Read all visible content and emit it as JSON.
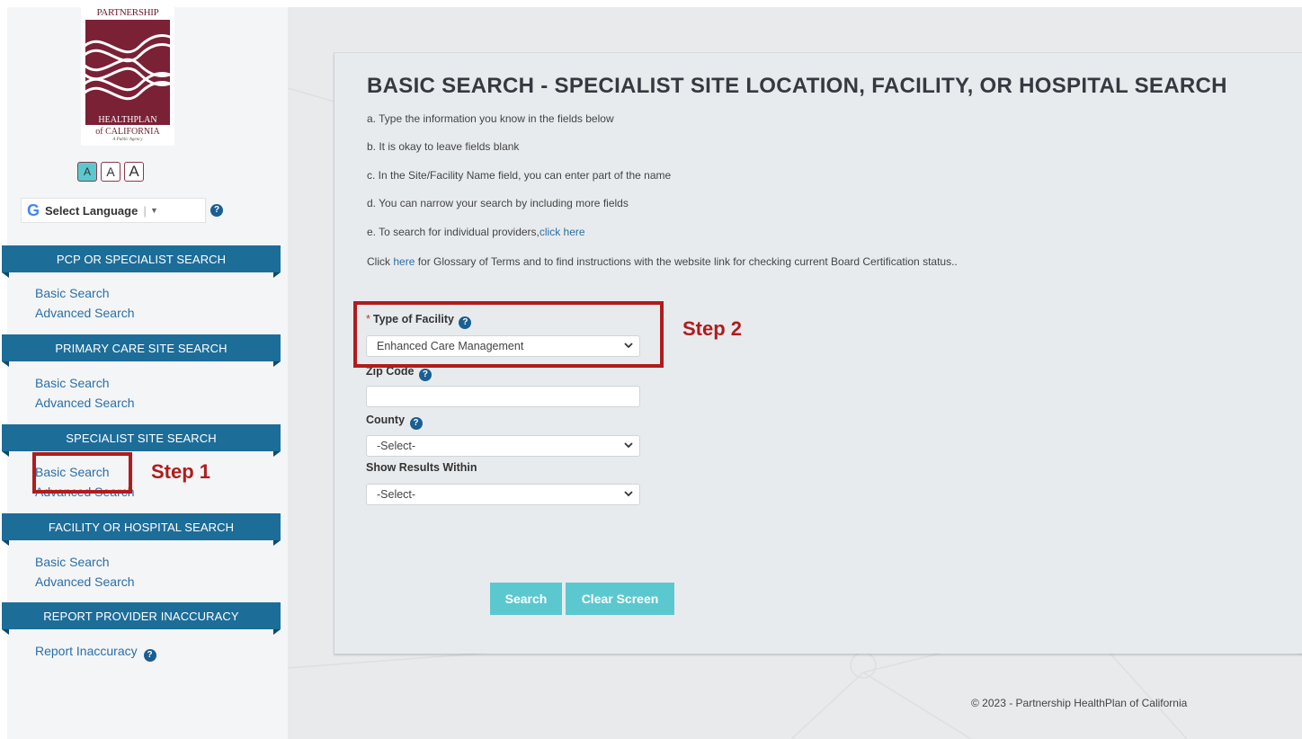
{
  "logo": {
    "top": "PARTNERSHIP",
    "middle": "HEALTHPLAN",
    "bottom": "of CALIFORNIA",
    "tagline": "A Public Agency"
  },
  "font_sizer": {
    "small": "A",
    "medium": "A",
    "large": "A"
  },
  "language": {
    "g": "G",
    "label": "Select Language",
    "arrow": "▼",
    "help": "?"
  },
  "sidebar": {
    "sections": [
      {
        "header": "PCP OR SPECIALIST SEARCH",
        "links": [
          "Basic Search",
          "Advanced Search"
        ]
      },
      {
        "header": "PRIMARY CARE SITE SEARCH",
        "links": [
          "Basic Search",
          "Advanced Search"
        ]
      },
      {
        "header": "SPECIALIST SITE SEARCH",
        "links": [
          "Basic Search",
          "Advanced Search"
        ]
      },
      {
        "header": "FACILITY OR HOSPITAL SEARCH",
        "links": [
          "Basic Search",
          "Advanced Search"
        ]
      },
      {
        "header": "REPORT PROVIDER INACCURACY",
        "links": [
          "Report Inaccuracy"
        ]
      }
    ]
  },
  "main": {
    "title": "BASIC SEARCH - SPECIALIST SITE LOCATION, FACILITY, OR HOSPITAL SEARCH",
    "instructions": {
      "a": "a. Type the information you know in the fields below",
      "b": "b. It is okay to leave fields blank",
      "c": "c. In the Site/Facility Name field, you can enter part of the name",
      "d": "d. You can narrow your search by including more fields",
      "e_prefix": "e. To search for individual providers,",
      "e_link": "click here",
      "glossary_prefix": "Click ",
      "glossary_link": "here",
      "glossary_suffix": " for Glossary of Terms and to find instructions with the website link for checking current Board Certification status.."
    },
    "form": {
      "facility_type": {
        "required_mark": "*",
        "label": "Type of Facility",
        "value": "Enhanced Care Management"
      },
      "zip_code": {
        "label": "Zip Code",
        "value": ""
      },
      "county": {
        "label": "County",
        "value": "-Select-"
      },
      "results_within": {
        "label": "Show Results Within",
        "value": "-Select-"
      }
    },
    "buttons": {
      "search": "Search",
      "clear": "Clear Screen"
    }
  },
  "annotations": {
    "step1": "Step 1",
    "step2": "Step 2"
  },
  "footer": "© 2023 - Partnership HealthPlan of California",
  "colors": {
    "nav_header": "#1d6d99",
    "link": "#2a6fa8",
    "button": "#5bc8d0",
    "annotation": "#b01c1c",
    "logo": "#6b1d2e"
  }
}
